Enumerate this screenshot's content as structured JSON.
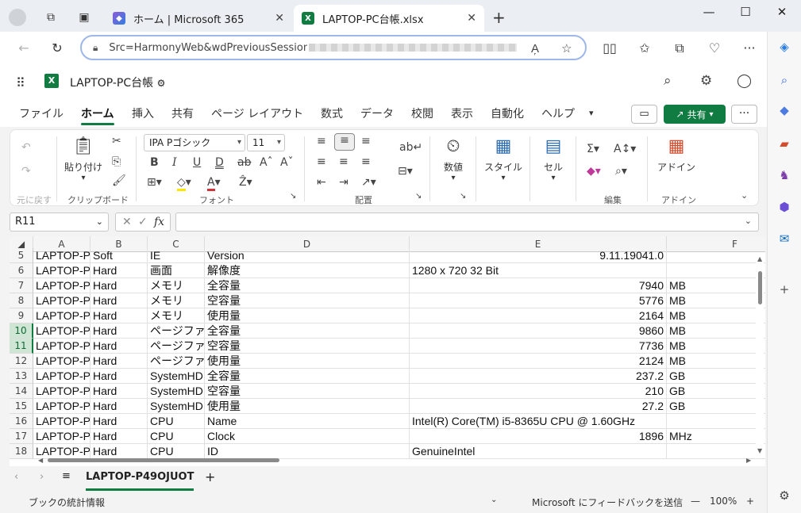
{
  "browser": {
    "tabs": [
      {
        "title": "ホーム | Microsoft 365",
        "icon": "m365-icon",
        "active": false
      },
      {
        "title": "LAPTOP-PC台帳.xlsx",
        "icon": "excel-icon",
        "active": true
      }
    ],
    "url": "Src=HarmonyWeb&wdPreviousSession="
  },
  "app": {
    "doc_name": "LAPTOP-PC台帳",
    "menu": [
      "ファイル",
      "ホーム",
      "挿入",
      "共有",
      "ページ レイアウト",
      "数式",
      "データ",
      "校閲",
      "表示",
      "自動化",
      "ヘルプ"
    ],
    "active_menu": "ホーム",
    "share_label": "共有"
  },
  "ribbon": {
    "undo_group": "元に戻す",
    "paste_label": "貼り付け",
    "clipboard_group": "クリップボード",
    "font_name": "IPA Pゴシック",
    "font_size": "11",
    "font_group": "フォント",
    "align_group": "配置",
    "number_label": "数値",
    "style_label": "スタイル",
    "cell_label": "セル",
    "edit_group": "編集",
    "addin_label": "アドイン",
    "addin_group": "アドイン"
  },
  "formula_bar": {
    "name_box": "R11",
    "fx": "fx",
    "value": ""
  },
  "grid": {
    "columns": [
      "A",
      "B",
      "C",
      "D",
      "E",
      "F"
    ],
    "rows": [
      {
        "n": "5",
        "a": "LAPTOP-P",
        "b": "Soft",
        "c": "IE",
        "d": "Version",
        "e": "9.11.19041.0",
        "f": ""
      },
      {
        "n": "6",
        "a": "LAPTOP-P",
        "b": "Hard",
        "c": "画面",
        "d": "解像度",
        "e": "1280 x 720 32 Bit",
        "f": ""
      },
      {
        "n": "7",
        "a": "LAPTOP-P",
        "b": "Hard",
        "c": "メモリ",
        "d": "全容量",
        "e": "7940",
        "f": "MB"
      },
      {
        "n": "8",
        "a": "LAPTOP-P",
        "b": "Hard",
        "c": "メモリ",
        "d": "空容量",
        "e": "5776",
        "f": "MB"
      },
      {
        "n": "9",
        "a": "LAPTOP-P",
        "b": "Hard",
        "c": "メモリ",
        "d": "使用量",
        "e": "2164",
        "f": "MB"
      },
      {
        "n": "10",
        "a": "LAPTOP-P",
        "b": "Hard",
        "c": "ページファ",
        "d": "全容量",
        "e": "9860",
        "f": "MB"
      },
      {
        "n": "11",
        "a": "LAPTOP-P",
        "b": "Hard",
        "c": "ページファ",
        "d": "空容量",
        "e": "7736",
        "f": "MB"
      },
      {
        "n": "12",
        "a": "LAPTOP-P",
        "b": "Hard",
        "c": "ページファ",
        "d": "使用量",
        "e": "2124",
        "f": "MB"
      },
      {
        "n": "13",
        "a": "LAPTOP-P",
        "b": "Hard",
        "c": "SystemHD",
        "d": "全容量",
        "e": "237.2",
        "f": "GB"
      },
      {
        "n": "14",
        "a": "LAPTOP-P",
        "b": "Hard",
        "c": "SystemHD",
        "d": "空容量",
        "e": "210",
        "f": "GB"
      },
      {
        "n": "15",
        "a": "LAPTOP-P",
        "b": "Hard",
        "c": "SystemHD",
        "d": "使用量",
        "e": "27.2",
        "f": "GB"
      },
      {
        "n": "16",
        "a": "LAPTOP-P",
        "b": "Hard",
        "c": "CPU",
        "d": "Name",
        "e": "Intel(R) Core(TM) i5-8365U CPU @ 1.60GHz",
        "f": ""
      },
      {
        "n": "17",
        "a": "LAPTOP-P",
        "b": "Hard",
        "c": "CPU",
        "d": "Clock",
        "e": "1896",
        "f": "MHz"
      },
      {
        "n": "18",
        "a": "LAPTOP-P",
        "b": "Hard",
        "c": "CPU",
        "d": "ID",
        "e": "GenuineIntel",
        "f": ""
      }
    ],
    "selected_rows": [
      "10",
      "11"
    ]
  },
  "sheets": {
    "active": "LAPTOP-P49OJUOT"
  },
  "status": {
    "left": "ブックの統計情報",
    "feedback": "Microsoft にフィードバックを送信",
    "zoom": "100%"
  },
  "colors": {
    "accent": "#107c41",
    "selection": "#cfe6d5"
  }
}
